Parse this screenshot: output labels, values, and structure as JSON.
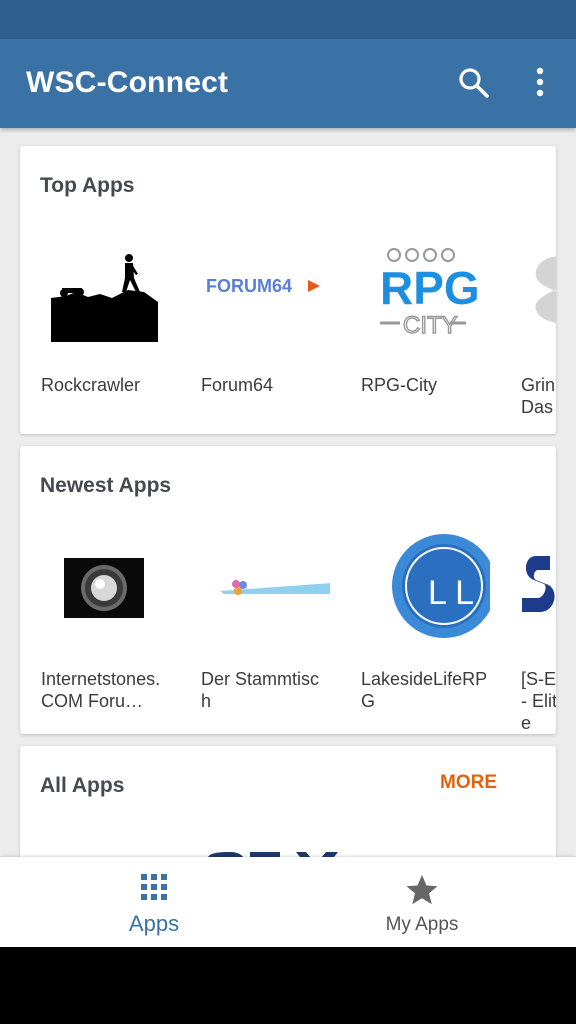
{
  "app_bar": {
    "title": "WSC-Connect",
    "icons": [
      "search-icon",
      "more-vert-icon"
    ]
  },
  "sections": {
    "top_apps": {
      "title": "Top Apps",
      "apps": [
        {
          "label": "Rockcrawler",
          "icon": "rockcrawler-logo"
        },
        {
          "label": "Forum64",
          "icon": "forum64-logo",
          "logo_text": "FORUM64"
        },
        {
          "label": "RPG-City",
          "icon": "rpg-city-logo",
          "logo_text": "RPG",
          "logo_subtext": "CITY"
        },
        {
          "label": "Grin Das",
          "icon": "grin-logo"
        }
      ]
    },
    "newest_apps": {
      "title": "Newest Apps",
      "apps": [
        {
          "label": "Internetstones.COM Foru…",
          "icon": "internetstones-logo"
        },
        {
          "label": "Der Stammtisch",
          "icon": "stammtisch-logo"
        },
        {
          "label": "LakesideLifeRPG",
          "icon": "lakesidelife-logo",
          "logo_text": "L L"
        },
        {
          "label": "[S-E- Elite",
          "icon": "se-elite-logo"
        }
      ]
    },
    "all_apps": {
      "title": "All Apps",
      "more_label": "MORE"
    }
  },
  "bottom_nav": {
    "apps_label": "Apps",
    "my_apps_label": "My Apps",
    "icons": [
      "apps-grid-icon",
      "star-icon"
    ]
  },
  "colors": {
    "status_bar": "#2e5f8d",
    "app_bar": "#3a72a6",
    "accent": "#e0630e",
    "nav_active": "#3a72a6",
    "nav_inactive": "#666666"
  }
}
